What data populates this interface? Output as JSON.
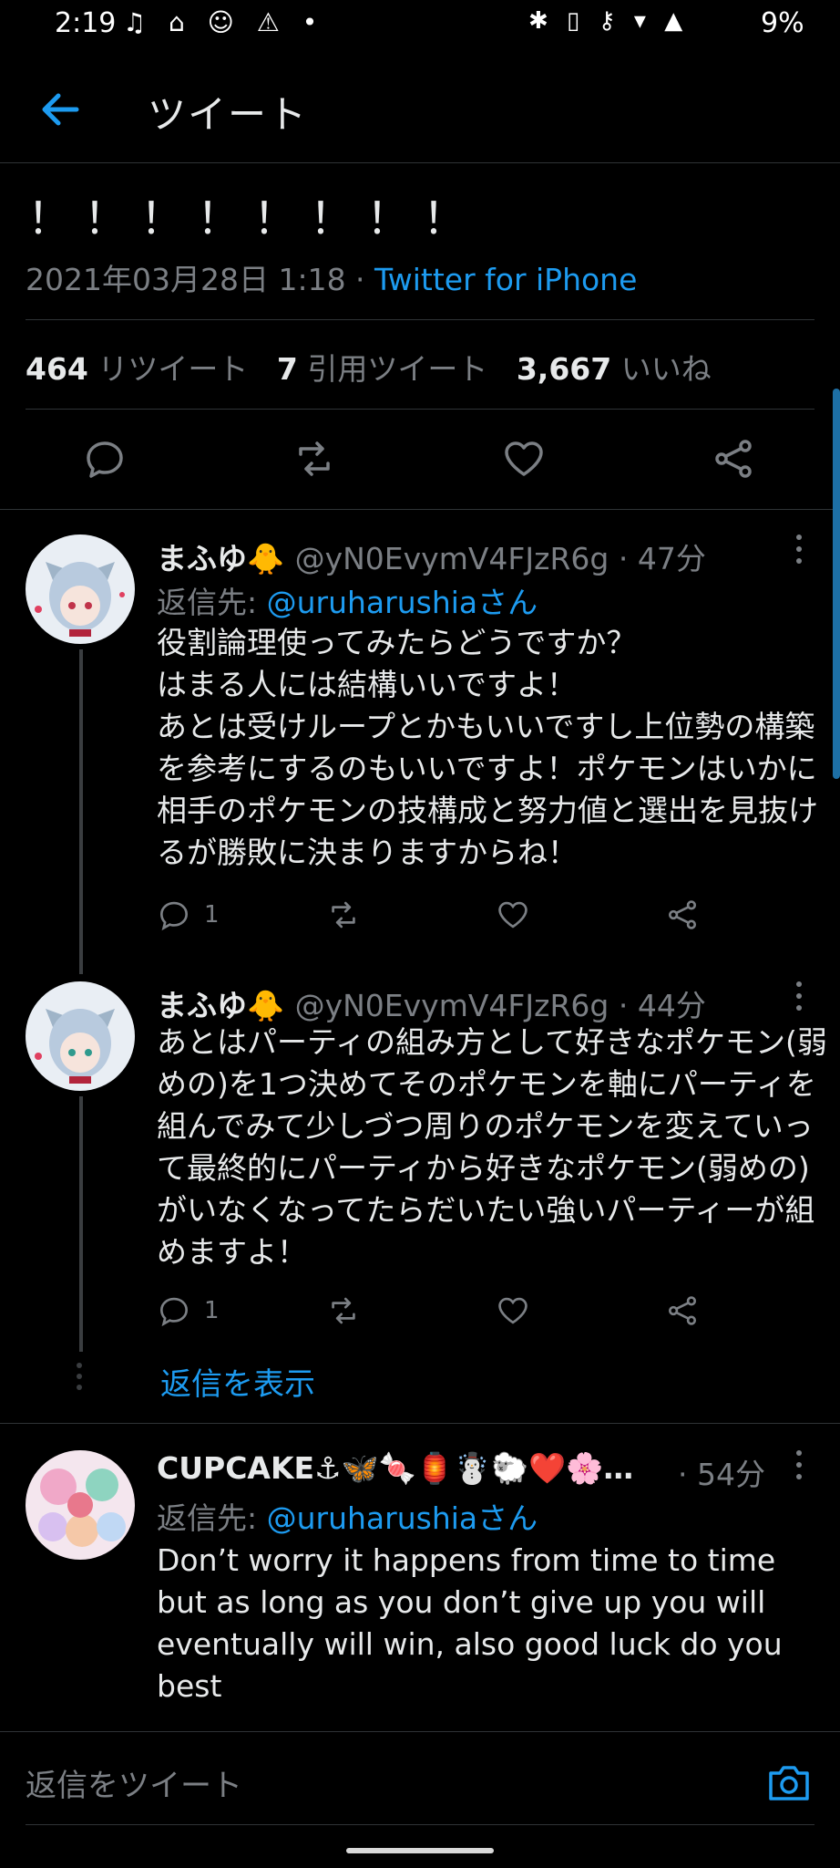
{
  "status_bar": {
    "time": "2:19",
    "left_icons": "♫ ⌂ ☺ ⚠ •",
    "right_icons": "✱ ▯ ⚷ ▾ ▲",
    "battery": "9%"
  },
  "header": {
    "title": "ツイート"
  },
  "main_tweet": {
    "text": "！！！！！！！！",
    "date": "2021年03月28日 1:18",
    "separator": " · ",
    "source": "Twitter for iPhone",
    "retweets_count": "464",
    "retweets_label": "リツイート",
    "quotes_count": "7",
    "quotes_label": "引用ツイート",
    "likes_count": "3,667",
    "likes_label": "いいね"
  },
  "replies": [
    {
      "name": "まふゆ🐥",
      "handle": "@yN0EvymV4FJzR6g",
      "time": "47分",
      "reply_to_label": "返信先: ",
      "reply_to_user": "@uruharushiaさん",
      "body": "役割論理使ってみたらどうですか？\nはまる人には結構いいですよ！\nあとは受けループとかもいいですし上位勢の構築を参考にするのもいいですよ！ポケモンはいかに相手のポケモンの技構成と努力値と選出を見抜けるが勝敗に決まりますからね！",
      "reply_count": "1"
    },
    {
      "name": "まふゆ🐥",
      "handle": "@yN0EvymV4FJzR6g",
      "time": "44分",
      "body": "あとはパーティの組み方として好きなポケモン(弱めの)を1つ決めてそのポケモンを軸にパーティを組んでみて少しづつ周りのポケモンを変えていって最終的にパーティから好きなポケモン(弱めの)がいなくなってたらだいたい強いパーティーが組めますよ！",
      "reply_count": "1"
    },
    {
      "name": "CUPCAKE⚓🦋🍬🏮☃️🐑❤️🌸…",
      "time": "54分",
      "reply_to_label": "返信先: ",
      "reply_to_user": "@uruharushiaさん",
      "body": "Don’t worry it happens from time to time but as long as you don’t give up you will eventually will win, also good luck do you best"
    }
  ],
  "show_replies": "返信を表示",
  "compose": {
    "placeholder": "返信をツイート"
  },
  "colors": {
    "accent": "#1d9bf0",
    "background": "#000000",
    "muted": "#7b7f84"
  }
}
